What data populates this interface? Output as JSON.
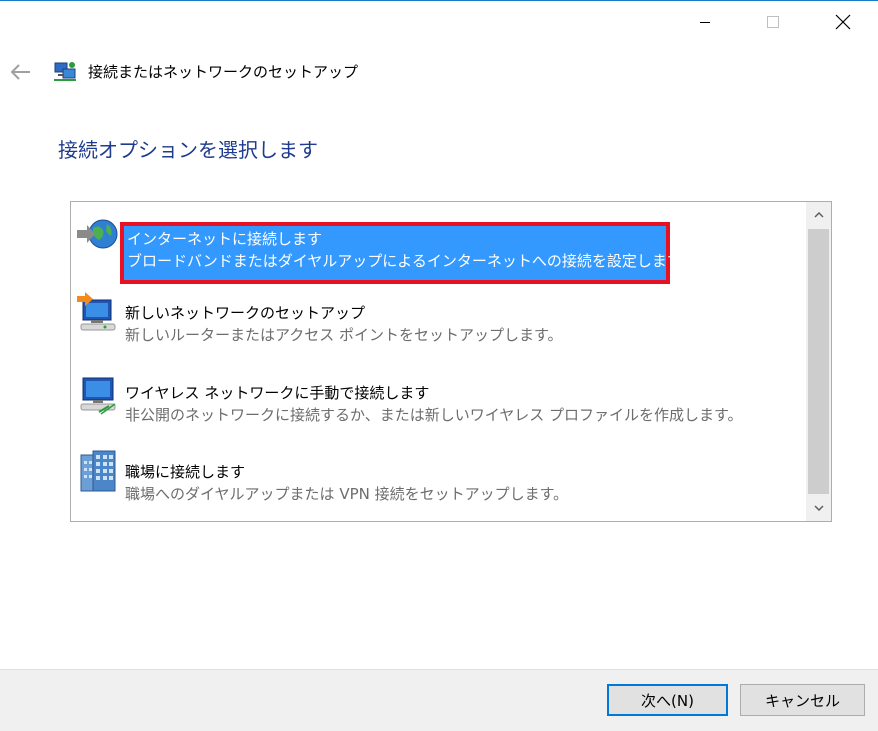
{
  "window": {
    "title": "接続またはネットワークのセットアップ",
    "controls": [
      "minimize",
      "maximize",
      "close"
    ]
  },
  "page": {
    "heading": "接続オプションを選択します"
  },
  "options": [
    {
      "title": "インターネットに接続します",
      "description": "ブロードバンドまたはダイヤルアップによるインターネットへの接続を設定します。",
      "icon": "globe-icon",
      "selected": true
    },
    {
      "title": "新しいネットワークのセットアップ",
      "description": "新しいルーターまたはアクセス ポイントをセットアップします。",
      "icon": "network-setup-icon",
      "selected": false
    },
    {
      "title": "ワイヤレス ネットワークに手動で接続します",
      "description": "非公開のネットワークに接続するか、または新しいワイヤレス プロファイルを作成します。",
      "icon": "wireless-network-icon",
      "selected": false
    },
    {
      "title": "職場に接続します",
      "description": "職場へのダイヤルアップまたは VPN 接続をセットアップします。",
      "icon": "workplace-building-icon",
      "selected": false
    }
  ],
  "buttons": {
    "next": "次へ(N)",
    "cancel": "キャンセル"
  },
  "colors": {
    "heading": "#1f3b8d",
    "selection": "#3399ff",
    "highlight_border": "#e81123",
    "default_button_border": "#0078d7"
  }
}
